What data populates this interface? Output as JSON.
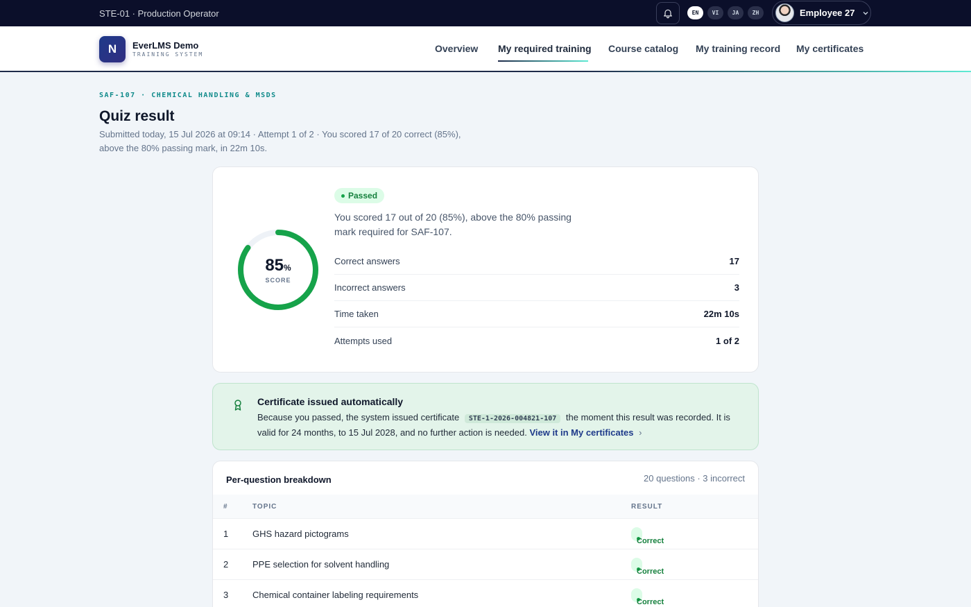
{
  "topbar": {
    "context": "STE-01 · Production Operator",
    "languages": [
      "EN",
      "VI",
      "JA",
      "ZH"
    ],
    "active_language": "EN",
    "user_name": "Employee 27"
  },
  "header": {
    "logo_letter": "N",
    "brand_name": "EverLMS Demo",
    "brand_sub": "TRAINING SYSTEM",
    "nav": [
      "Overview",
      "My required training",
      "Course catalog",
      "My training record",
      "My certificates"
    ],
    "active_nav": "My required training"
  },
  "page": {
    "breadcrumb": "SAF-107 · CHEMICAL HANDLING & MSDS",
    "title": "Quiz result",
    "subtitle": "Submitted today, 15 Jul 2026 at 09:14 · Attempt 1 of 2 · You scored 17 of 20 correct (85%), above the 80% passing mark, in 22m 10s."
  },
  "score": {
    "value": "85",
    "unit": "%",
    "label": "SCORE",
    "fraction": 0.85,
    "status": "Passed",
    "summary": "You scored 17 out of 20 (85%), above the 80% passing mark required for SAF-107.",
    "stats": [
      {
        "label": "Correct answers",
        "value": "17"
      },
      {
        "label": "Incorrect answers",
        "value": "3"
      },
      {
        "label": "Time taken",
        "value": "22m 10s"
      },
      {
        "label": "Attempts used",
        "value": "1 of 2"
      }
    ]
  },
  "certificate": {
    "title": "Certificate issued automatically",
    "text_before": "Because you passed, the system issued certificate",
    "code": "STE-1-2026-004821-107",
    "text_after": "the moment this result was recorded. It is valid for 24 months, to 15 Jul 2028, and no further action is needed.",
    "link_text": "View it in My certificates",
    "link_arrow": "›"
  },
  "breakdown": {
    "title": "Per-question breakdown",
    "meta": "20 questions · 3 incorrect",
    "headers": {
      "num": "#",
      "topic": "TOPIC",
      "result": "RESULT"
    },
    "rows": [
      {
        "num": "1",
        "topic": "GHS hazard pictograms",
        "result": "Correct"
      },
      {
        "num": "2",
        "topic": "PPE selection for solvent handling",
        "result": "Correct"
      },
      {
        "num": "3",
        "topic": "Chemical container labeling requirements",
        "result": "Correct"
      }
    ]
  },
  "colors": {
    "topbar": "#0b0f2a",
    "ring_progress": "#16a34a",
    "ring_track": "#eef2f7",
    "pass_badge_bg": "#dcfce7",
    "pass_badge_text": "#15803d",
    "cert_bg": "#e3f4ea",
    "accent_teal": "#0f8a8a"
  }
}
